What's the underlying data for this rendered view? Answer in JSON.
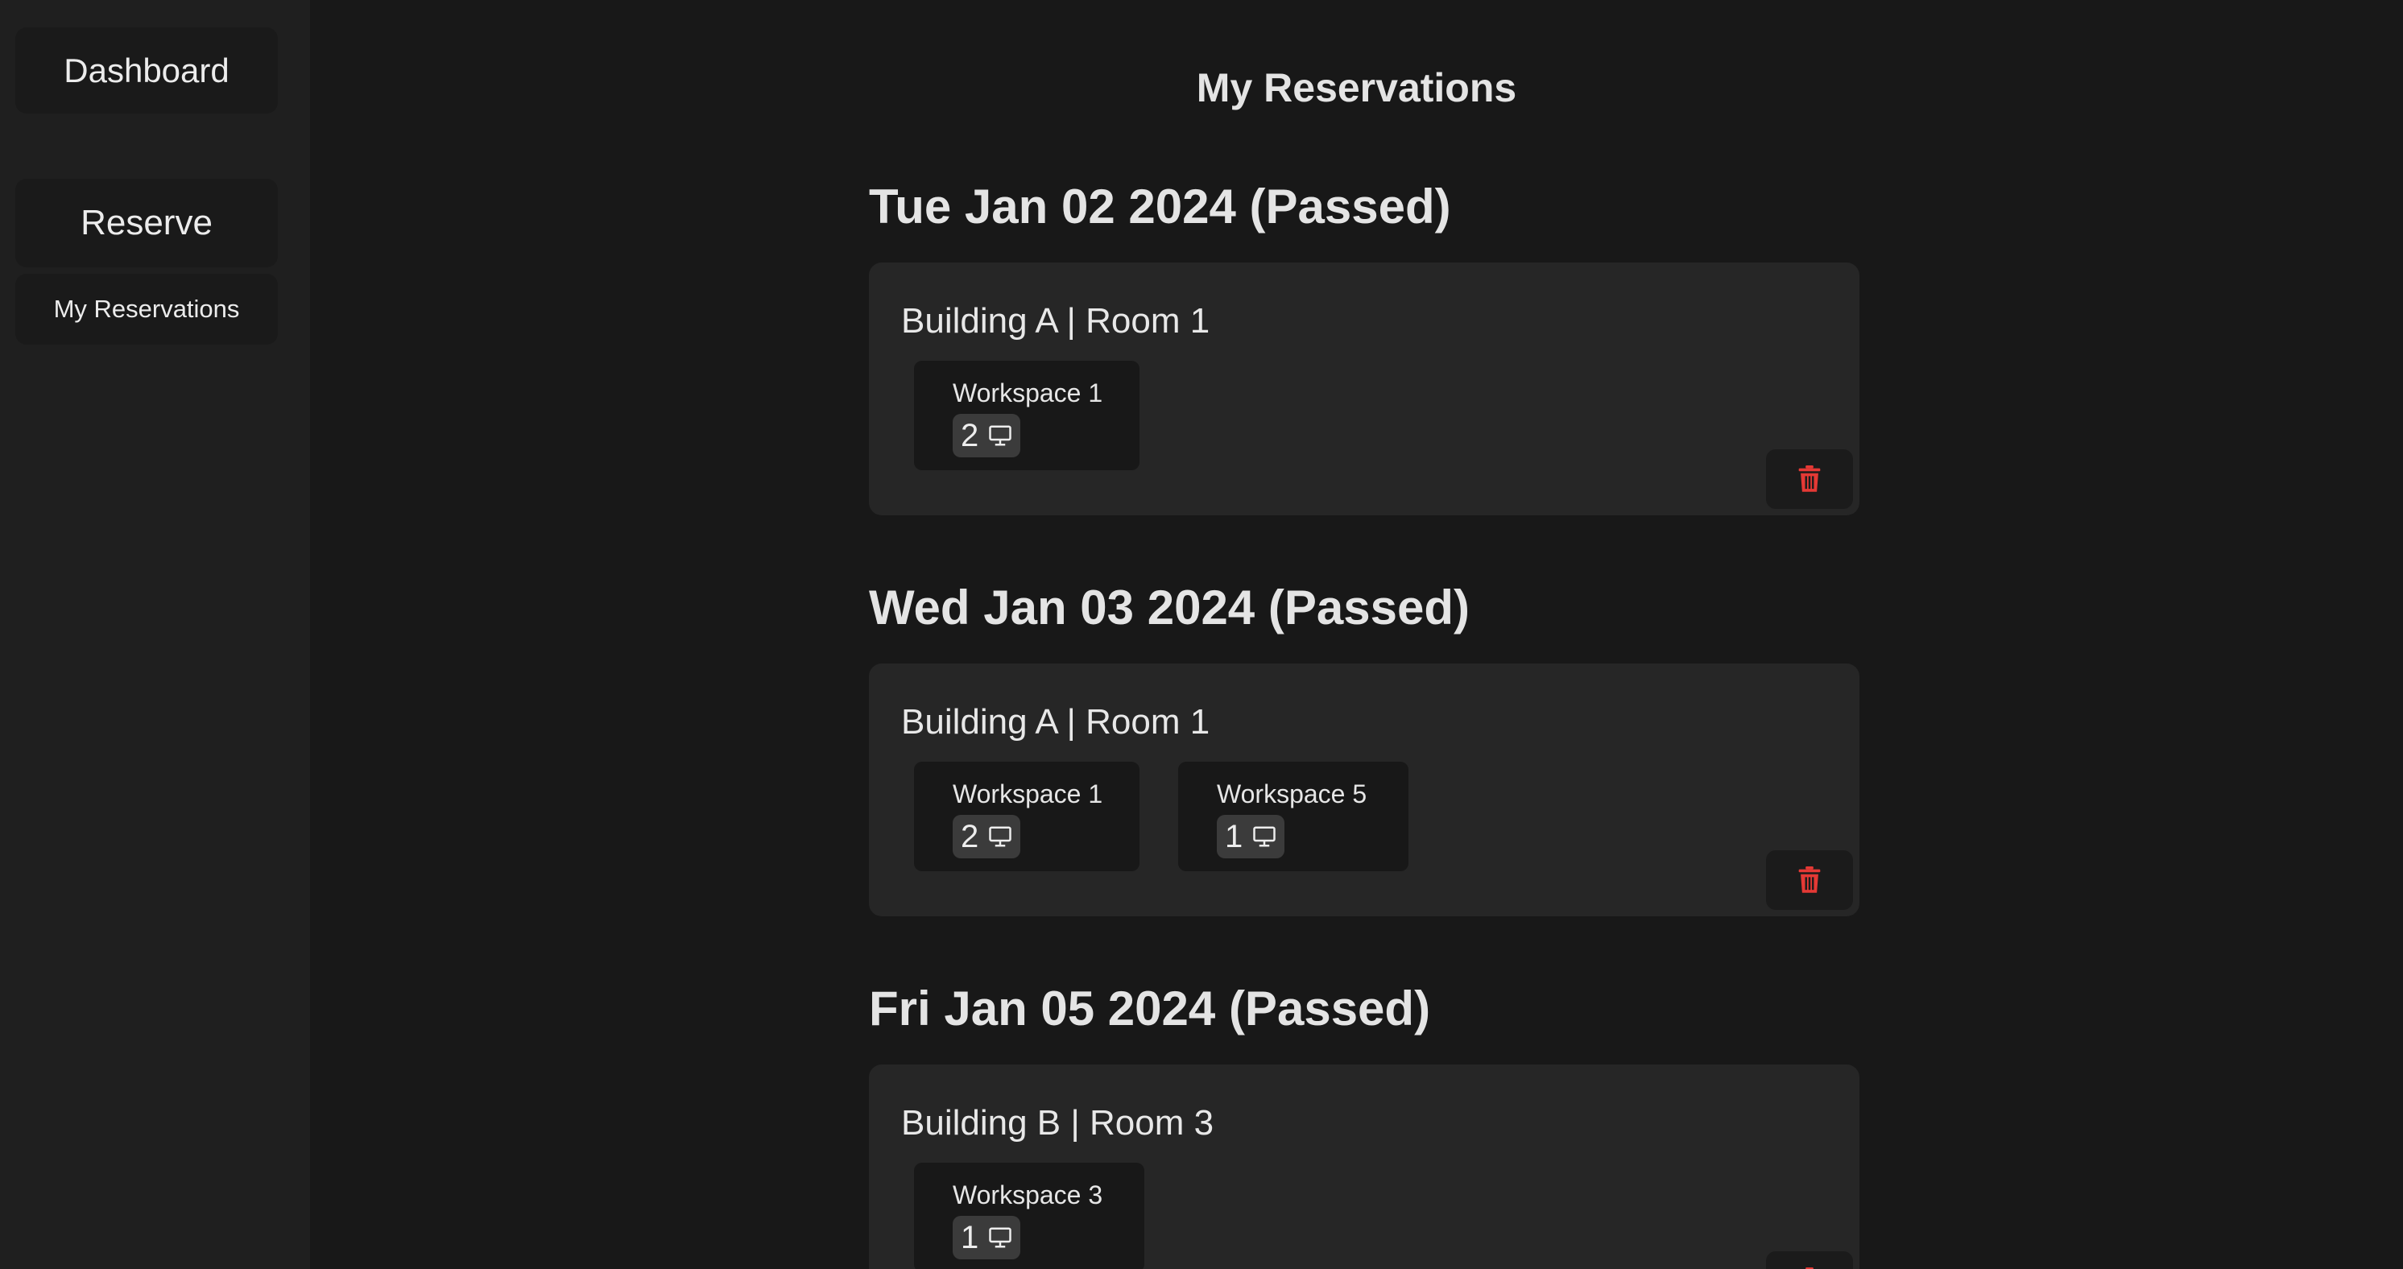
{
  "sidebar": {
    "items": [
      {
        "label": "Dashboard"
      },
      {
        "label": "Reserve"
      },
      {
        "label": "My Reservations"
      }
    ]
  },
  "page": {
    "title": "My Reservations"
  },
  "reservations": [
    {
      "date": "Tue Jan 02 2024 (Passed)",
      "location": "Building A | Room 1",
      "workspaces": [
        {
          "name": "Workspace 1",
          "count": "2",
          "icon": "monitor-icon"
        }
      ],
      "delete_icon": "trash-icon"
    },
    {
      "date": "Wed Jan 03 2024 (Passed)",
      "location": "Building A | Room 1",
      "workspaces": [
        {
          "name": "Workspace 1",
          "count": "2",
          "icon": "monitor-icon"
        },
        {
          "name": "Workspace 5",
          "count": "1",
          "icon": "monitor-icon"
        }
      ],
      "delete_icon": "trash-icon"
    },
    {
      "date": "Fri Jan 05 2024 (Passed)",
      "location": "Building B | Room 3",
      "workspaces": [
        {
          "name": "Workspace 3",
          "count": "1",
          "icon": "monitor-icon"
        }
      ],
      "delete_icon": "trash-icon"
    }
  ],
  "colors": {
    "background": "#181818",
    "sidebar": "#1f1f1f",
    "card": "#262626",
    "delete": "#e53935"
  }
}
